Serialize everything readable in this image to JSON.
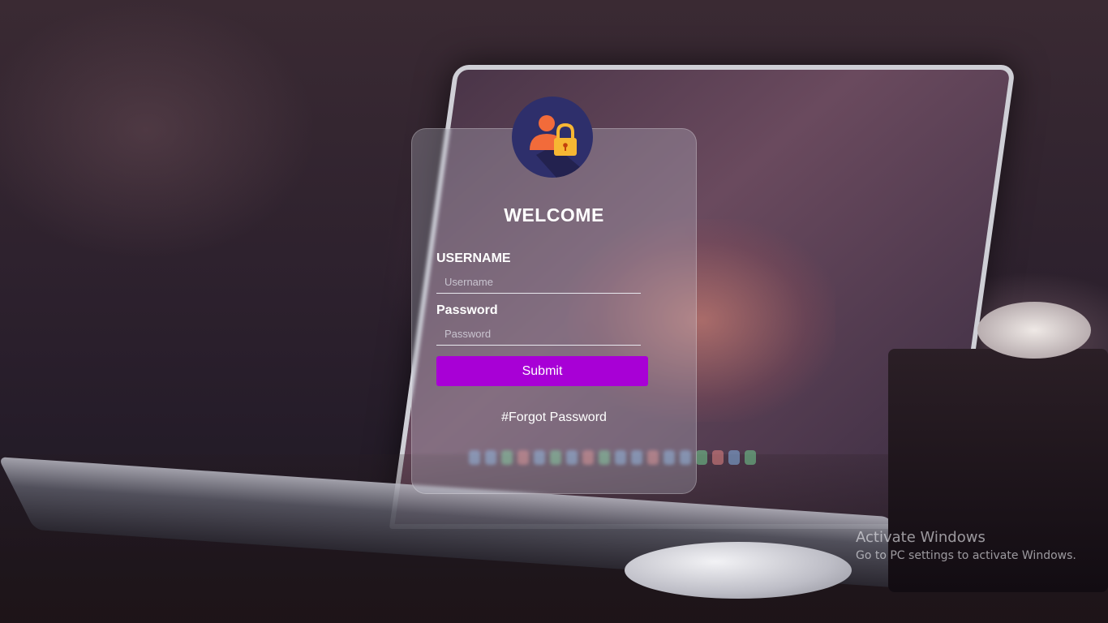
{
  "login": {
    "title": "WELCOME",
    "username_label": "USERNAME",
    "username_placeholder": "Username",
    "password_label": "Password",
    "password_placeholder": "Password",
    "submit_label": "Submit",
    "forgot_label": "#Forgot Password"
  },
  "avatar": {
    "icon": "user-lock-icon",
    "background": "#2e2f6b",
    "person_color": "#f26b3a",
    "lock_color": "#f7b733"
  },
  "colors": {
    "submit_background": "#a800d6",
    "text": "#ffffff"
  },
  "watermark": {
    "title": "Activate Windows",
    "subtitle": "Go to PC settings to activate Windows."
  }
}
